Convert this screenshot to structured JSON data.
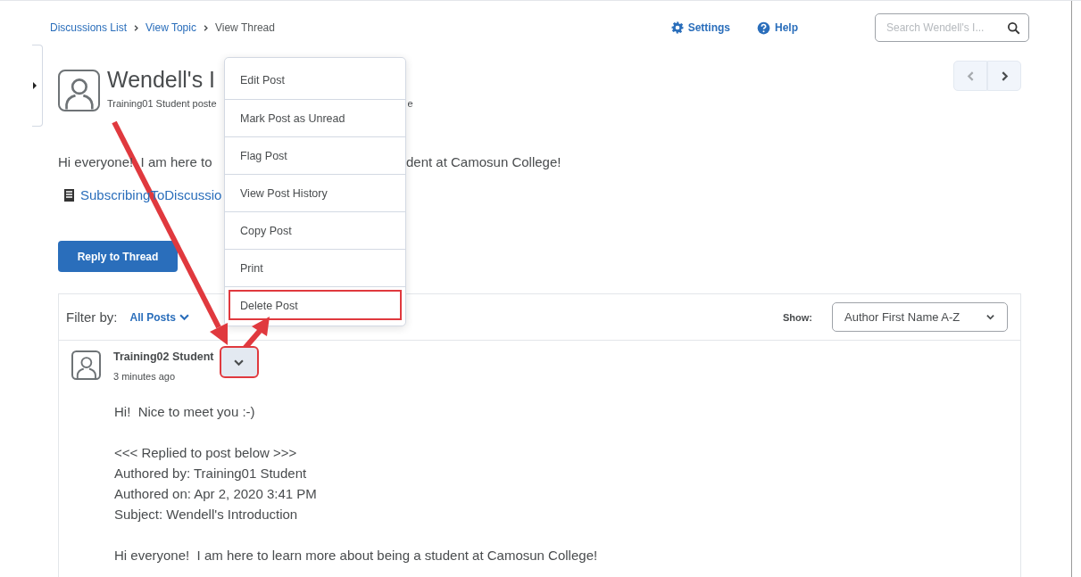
{
  "breadcrumbs": [
    {
      "label": "Discussions List",
      "link": true
    },
    {
      "label": "View Topic",
      "link": true
    },
    {
      "label": "View Thread",
      "link": false
    }
  ],
  "toolbar": {
    "settings": "Settings",
    "help": "Help",
    "search": {
      "placeholder": "Search Wendell's I..."
    }
  },
  "pager": {
    "previous": {
      "disabled": true
    },
    "next": {
      "disabled": false
    }
  },
  "thread": {
    "title": "Wendell's I",
    "byline": [
      "Training01 Student poste",
      "e"
    ],
    "body": [
      "Hi everyone!  I am here to",
      "dent at Camosun College!"
    ],
    "attachment": "SubscribingToDiscussio",
    "reply_button": "Reply to Thread"
  },
  "filter": {
    "label": "Filter by:",
    "value": "All Posts",
    "show_label": "Show:",
    "sort": "Author First Name A-Z"
  },
  "post": {
    "author": "Training02 Student",
    "time": "3 minutes ago",
    "menu_button": {
      "annotated": true
    },
    "paragraphs": [
      {
        "lines": [
          "Hi!  Nice to meet you :-)"
        ]
      },
      {
        "lines": [
          "<<< Replied to post below >>>",
          "Authored by: Training01 Student",
          "Authored on: Apr 2, 2020 3:41 PM",
          "Subject: Wendell's Introduction"
        ]
      },
      {
        "lines": [
          "Hi everyone!  I am here to learn more about being a student at Camosun College!"
        ]
      }
    ]
  },
  "context_menu": {
    "items": [
      {
        "label": "Edit Post",
        "annotated": false
      },
      {
        "label": "Mark Post as Unread",
        "annotated": false
      },
      {
        "label": "Flag Post",
        "annotated": false
      },
      {
        "label": "View Post History",
        "annotated": false
      },
      {
        "label": "Copy Post",
        "annotated": false
      },
      {
        "label": "Print",
        "annotated": false
      },
      {
        "label": "Delete Post",
        "annotated": true
      }
    ]
  }
}
